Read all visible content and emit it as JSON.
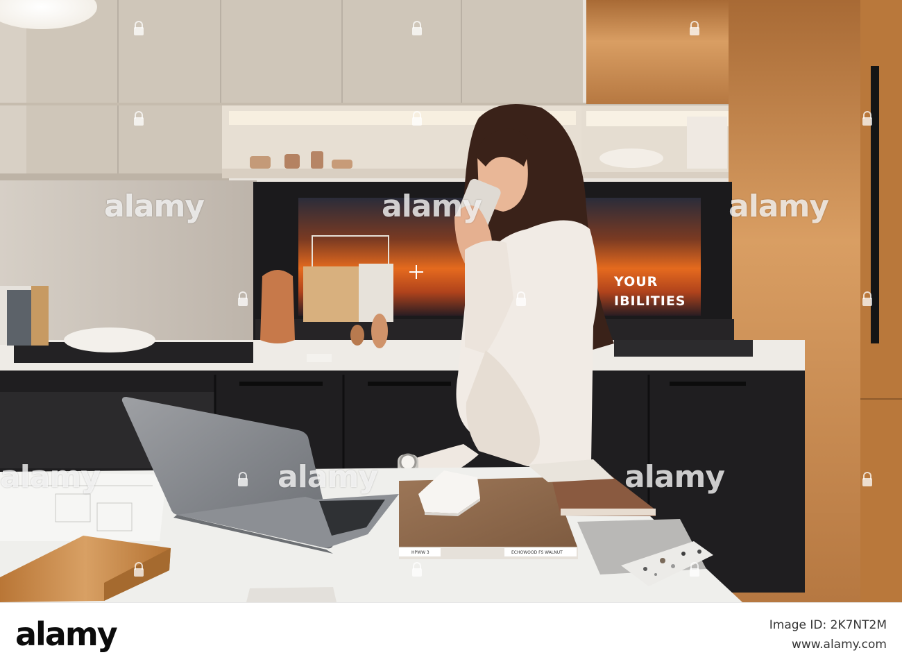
{
  "scene": {
    "description_colors": {
      "cabinet_beige": "#cfc5b8",
      "wood_panel": "#c98a4b",
      "counter_white": "#eeeeea",
      "black_cabinet": "#1e1d1e",
      "sunset_orange": "#e2661f",
      "blazer_white": "#f1ebe6",
      "hair_brown": "#3a2219"
    },
    "screen_text": {
      "line1": "YOUR",
      "line2": "IBILITIES"
    },
    "sample_labels": {
      "left": "HPWW 3",
      "right": "ECHOWOOD FS WALNUT"
    }
  },
  "watermark": {
    "text": "alamy"
  },
  "footer": {
    "logo": "alamy",
    "image_id": "Image ID: 2K7NT2M",
    "url": "www.alamy.com"
  }
}
